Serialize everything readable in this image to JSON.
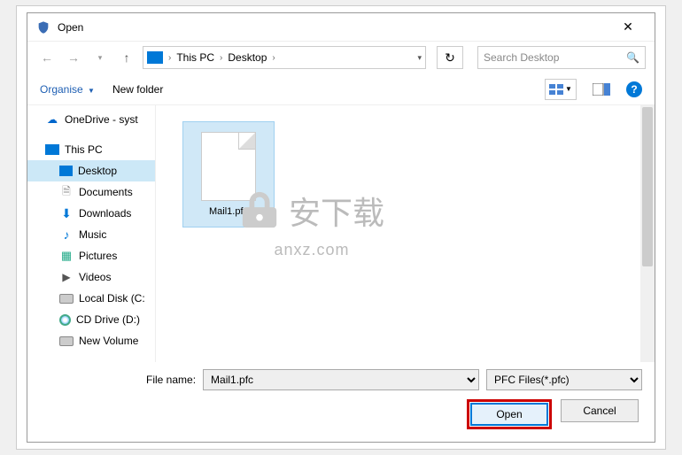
{
  "title": "Open",
  "breadcrumb": {
    "root": "This PC",
    "folder": "Desktop"
  },
  "search_placeholder": "Search Desktop",
  "toolbar": {
    "organise": "Organise",
    "newfolder": "New folder"
  },
  "sidebar": {
    "onedrive": "OneDrive - syst",
    "thispc": "This PC",
    "items": [
      {
        "label": "Desktop"
      },
      {
        "label": "Documents"
      },
      {
        "label": "Downloads"
      },
      {
        "label": "Music"
      },
      {
        "label": "Pictures"
      },
      {
        "label": "Videos"
      },
      {
        "label": "Local Disk (C:"
      },
      {
        "label": "CD Drive (D:)"
      },
      {
        "label": "New Volume"
      }
    ]
  },
  "file": {
    "name": "Mail1.pfc"
  },
  "filename_label": "File name:",
  "filename_value": "Mail1.pfc",
  "filetype_value": "PFC Files(*.pfc)",
  "buttons": {
    "open": "Open",
    "cancel": "Cancel"
  },
  "watermark": {
    "text": "安下载",
    "sub": "anxz.com"
  }
}
